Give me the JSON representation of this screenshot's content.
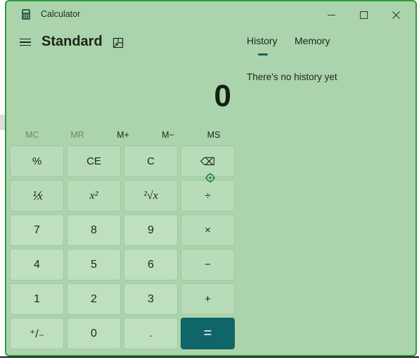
{
  "app": {
    "title": "Calculator",
    "mode": "Standard"
  },
  "window_controls": {
    "minimize": "minimize-icon",
    "maximize": "maximize-icon",
    "close": "close-icon"
  },
  "display": {
    "value": "0"
  },
  "memory": {
    "buttons": [
      {
        "label": "MC",
        "enabled": false
      },
      {
        "label": "MR",
        "enabled": false
      },
      {
        "label": "M+",
        "enabled": true
      },
      {
        "label": "M−",
        "enabled": true
      },
      {
        "label": "MS",
        "enabled": true
      }
    ]
  },
  "keys": [
    [
      "%",
      "CE",
      "C",
      "⌫"
    ],
    [
      "⅟x",
      "x²",
      "²√x",
      "÷"
    ],
    [
      "7",
      "8",
      "9",
      "×"
    ],
    [
      "4",
      "5",
      "6",
      "−"
    ],
    [
      "1",
      "2",
      "3",
      "+"
    ],
    [
      "⁺/₋",
      "0",
      ".",
      "="
    ]
  ],
  "panel": {
    "tabs": [
      "History",
      "Memory"
    ],
    "active_tab": "History",
    "history_empty_text": "There's no history yet"
  },
  "colors": {
    "accent": "#0f6567",
    "window_bg": "#acd4ac",
    "window_border": "#2e9a3e"
  }
}
